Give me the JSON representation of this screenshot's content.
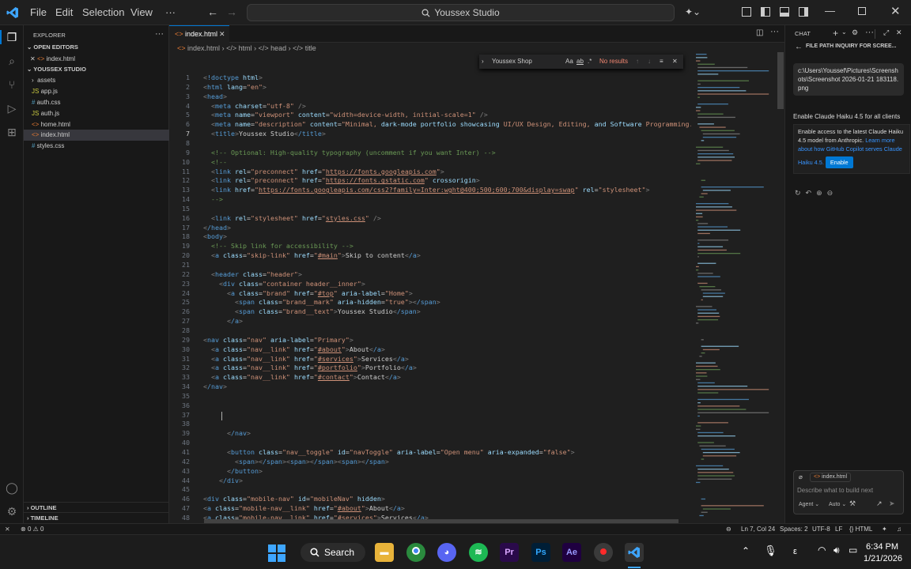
{
  "titlebar": {
    "menus": [
      "File",
      "Edit",
      "Selection",
      "View",
      "···"
    ],
    "command_center": "Youssex Studio"
  },
  "sidebar": {
    "title": "EXPLORER",
    "open_editors_label": "OPEN EDITORS",
    "open_editor_file": "index.html",
    "folder_label": "YOUSSEX STUDIO",
    "files": [
      "assets",
      "app.js",
      "auth.css",
      "auth.js",
      "home.html",
      "index.html",
      "styles.css"
    ],
    "outline_label": "OUTLINE",
    "timeline_label": "TIMELINE"
  },
  "editor": {
    "tab_label": "index.html",
    "breadcrumbs": [
      "index.html",
      "html",
      "head",
      "title"
    ],
    "find": {
      "value": "Youssex Shop",
      "options": [
        "Aa",
        "ab",
        ".*"
      ],
      "result": "No results"
    },
    "line_numbers": [
      "1",
      "2",
      "3",
      "4",
      "5",
      "6",
      "7",
      "8",
      "9",
      "10",
      "11",
      "12",
      "13",
      "14",
      "15",
      "16",
      "17",
      "18",
      "19",
      "20",
      "21",
      "22",
      "23",
      "24",
      "25",
      "26",
      "27",
      "28",
      "29",
      "30",
      "31",
      "32",
      "33",
      "34",
      "35",
      "36",
      "37",
      "38",
      "39",
      "40",
      "41",
      "42",
      "43",
      "44",
      "45",
      "46",
      "47",
      "48"
    ],
    "current_line": "7",
    "lines": [
      "<!doctype html>",
      "<html lang=\"en\">",
      "<head>",
      "  <meta charset=\"utf-8\" />",
      "  <meta name=\"viewport\" content=\"width=device-width, initial-scale=1\" />",
      "  <meta name=\"description\" content=\"Minimal, dark-mode portfolio showcasing UI/UX Design, Editing, and Software Programming.\" />",
      "  <title>Youssex Studio</title>",
      "",
      "  <!-- Optional: High-quality typography (uncomment if you want Inter) -->",
      "  <!--",
      "  <link rel=\"preconnect\" href=\"https://fonts.googleapis.com\">",
      "  <link rel=\"preconnect\" href=\"https://fonts.gstatic.com\" crossorigin>",
      "  <link href=\"https://fonts.googleapis.com/css2?family=Inter:wght@400;500;600;700&display=swap\" rel=\"stylesheet\">",
      "  -->",
      "",
      "  <link rel=\"stylesheet\" href=\"styles.css\" />",
      "</head>",
      "<body>",
      "  <!-- Skip link for accessibility -->",
      "  <a class=\"skip-link\" href=\"#main\">Skip to content</a>",
      "",
      "  <header class=\"header\">",
      "    <div class=\"container header__inner\">",
      "      <a class=\"brand\" href=\"#top\" aria-label=\"Home\">",
      "        <span class=\"brand__mark\" aria-hidden=\"true\"></span>",
      "        <span class=\"brand__text\">Youssex Studio</span>",
      "      </a>",
      "",
      "<nav class=\"nav\" aria-label=\"Primary\">",
      "  <a class=\"nav__link\" href=\"#about\">About</a>",
      "  <a class=\"nav__link\" href=\"#services\">Services</a>",
      "  <a class=\"nav__link\" href=\"#portfolio\">Portfolio</a>",
      "  <a class=\"nav__link\" href=\"#contact\">Contact</a>",
      "</nav>",
      "",
      "",
      "",
      "",
      "      </nav>",
      "",
      "      <button class=\"nav__toggle\" id=\"navToggle\" aria-label=\"Open menu\" aria-expanded=\"false\">",
      "        <span></span><span></span><span></span>",
      "      </button>",
      "    </div>",
      "",
      "<div class=\"mobile-nav\" id=\"mobileNav\" hidden>",
      "<a class=\"mobile-nav__link\" href=\"#about\">About</a>",
      "<a class=\"mobile-nav__link\" href=\"#services\">Services</a>"
    ]
  },
  "chat": {
    "title": "CHAT",
    "session_title": "FILE PATH INQUIRY FOR SCREE...",
    "path_message": "c:\\Users\\Youssef\\Pictures\\Screenshots\\Screenshot 2026-01-21 183118.png",
    "notice_title": "Enable Claude Haiku 4.5 for all clients",
    "notice_body": "Enable access to the latest Claude Haiku 4.5 model from Anthropic.",
    "notice_link": "Learn more about how GitHub Copilot serves Claude Haiku 4.5.",
    "enable_button": "Enable",
    "context_chip": "index.html",
    "input_placeholder": "Describe what to build next",
    "mode": "Agent",
    "model": "Auto"
  },
  "statusbar": {
    "problems": "0",
    "warnings": "0",
    "position": "Ln 7, Col 24",
    "indent": "Spaces: 2",
    "encoding": "UTF-8",
    "eol": "LF",
    "language": "HTML"
  },
  "taskbar": {
    "search_label": "Search",
    "apps": [
      "Files",
      "Chrome",
      "Discord",
      "Spotify",
      "Pr",
      "Ps",
      "Ae",
      "Recorder",
      "VS Code"
    ],
    "time": "6:34 PM",
    "date": "1/21/2026",
    "language": "ε"
  },
  "colors": {
    "accent": "#0078d4",
    "background": "#1f1f1f",
    "tag": "#569cd6",
    "attribute": "#9cdcfe",
    "string": "#ce9178",
    "comment": "#6a9955"
  }
}
